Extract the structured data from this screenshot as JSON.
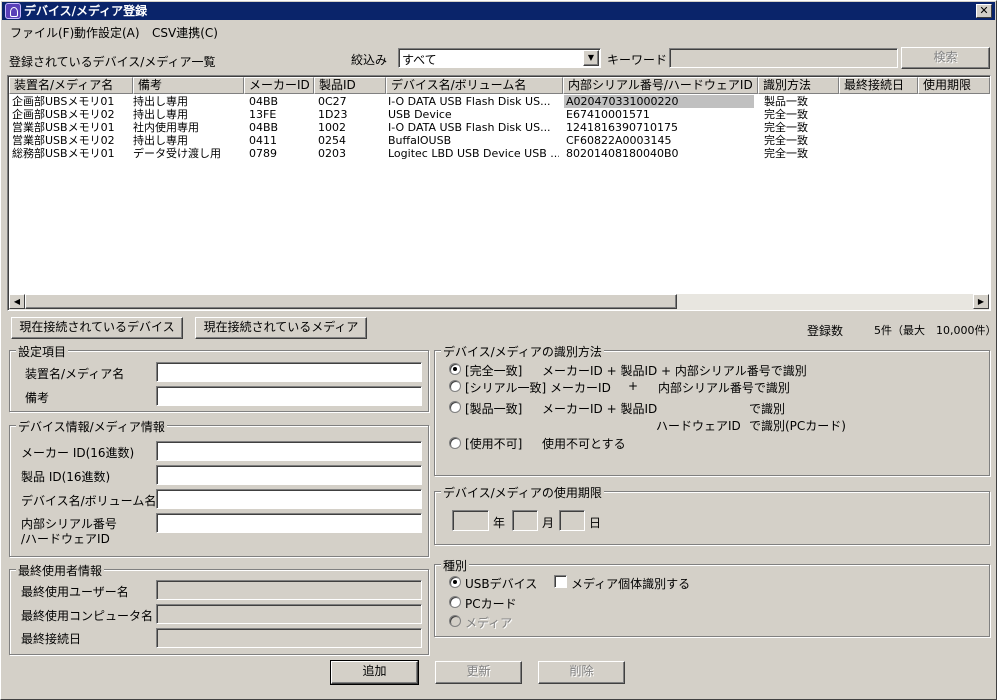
{
  "window": {
    "title": "デバイス/メディア登録",
    "close_label": "✕"
  },
  "menu": [
    {
      "label": "ファイル(F)"
    },
    {
      "label": "動作設定(A)"
    },
    {
      "label": "CSV連携(C)"
    }
  ],
  "toolbar": {
    "list_caption": "登録されているデバイス/メディア一覧",
    "filter_label": "絞込み",
    "filter_value": "すべて",
    "keyword_label": "キーワード",
    "keyword_value": "",
    "search_button": "検索"
  },
  "table": {
    "columns": [
      "装置名/メディア名",
      "備考",
      "メーカーID",
      "製品ID",
      "デバイス名/ボリューム名",
      "内部シリアル番号/ハードウェアID",
      "識別方法",
      "最終接続日",
      "使用期限"
    ],
    "rows": [
      [
        "企画部UBSメモリ01",
        "持出し専用",
        "04BB",
        "0C27",
        "I-O DATA USB Flash Disk US...",
        "A020470331000220",
        "製品一致",
        "",
        ""
      ],
      [
        "企画部USBメモリ02",
        "持出し専用",
        "13FE",
        "1D23",
        "USB Device",
        "E67410001571",
        "完全一致",
        "",
        ""
      ],
      [
        "営業部USBメモリ01",
        "社内使用専用",
        "04BB",
        "1002",
        "I-O DATA USB Flash Disk US...",
        "1241816390710175",
        "完全一致",
        "",
        ""
      ],
      [
        "営業部USBメモリ02",
        "持出し専用",
        "0411",
        "0254",
        "BuffalOUSB",
        "CF60822A0003145",
        "完全一致",
        "",
        ""
      ],
      [
        "総務部USBメモリ01",
        "データ受け渡し用",
        "0789",
        "0203",
        "Logitec LBD USB Device USB ...",
        "80201408180040B0",
        "完全一致",
        "",
        ""
      ]
    ]
  },
  "buttons": {
    "connected_devices": "現在接続されているデバイス",
    "connected_media": "現在接続されているメディア",
    "add": "追加",
    "update": "更新",
    "delete": "削除"
  },
  "count": {
    "label": "登録数",
    "value": "5件（最大　10,000件）"
  },
  "settings": {
    "title": "設定項目",
    "name_label": "装置名/メディア名",
    "name_value": "",
    "note_label": "備考",
    "note_value": ""
  },
  "device_info": {
    "title": "デバイス情報/メディア情報",
    "maker_label": "メーカー ID(16進数)",
    "product_label": "製品 ID(16進数)",
    "device_label": "デバイス名/ボリューム名",
    "serial_label_1": "内部シリアル番号",
    "serial_label_2": "/ハードウェアID"
  },
  "last_user": {
    "title": "最終使用者情報",
    "user_label": "最終使用ユーザー名",
    "computer_label": "最終使用コンピュータ名",
    "date_label": "最終接続日"
  },
  "identify": {
    "title": "デバイス/メディアの識別方法",
    "opt1_a": "[完全一致]",
    "opt1_b": "メーカーID + 製品ID + 内部シリアル番号で識別",
    "opt2_a": "[シリアル一致] メーカーID",
    "opt2_b": "+",
    "opt2_c": "内部シリアル番号で識別",
    "opt3_a": "[製品一致]",
    "opt3_b": "メーカーID + 製品ID",
    "opt3_c": "で識別",
    "opt3_d": "ハードウェアID",
    "opt3_e": "で識別(PCカード)",
    "opt4_a": "[使用不可]",
    "opt4_b": "使用不可とする",
    "selected": "完全一致"
  },
  "expiry": {
    "title": "デバイス/メディアの使用期限",
    "year": "年",
    "month": "月",
    "day": "日"
  },
  "kind": {
    "title": "種別",
    "usb": "USBデバイス",
    "media_individual": "メディア個体識別する",
    "pccard": "PCカード",
    "media": "メディア",
    "selected": "USBデバイス"
  }
}
